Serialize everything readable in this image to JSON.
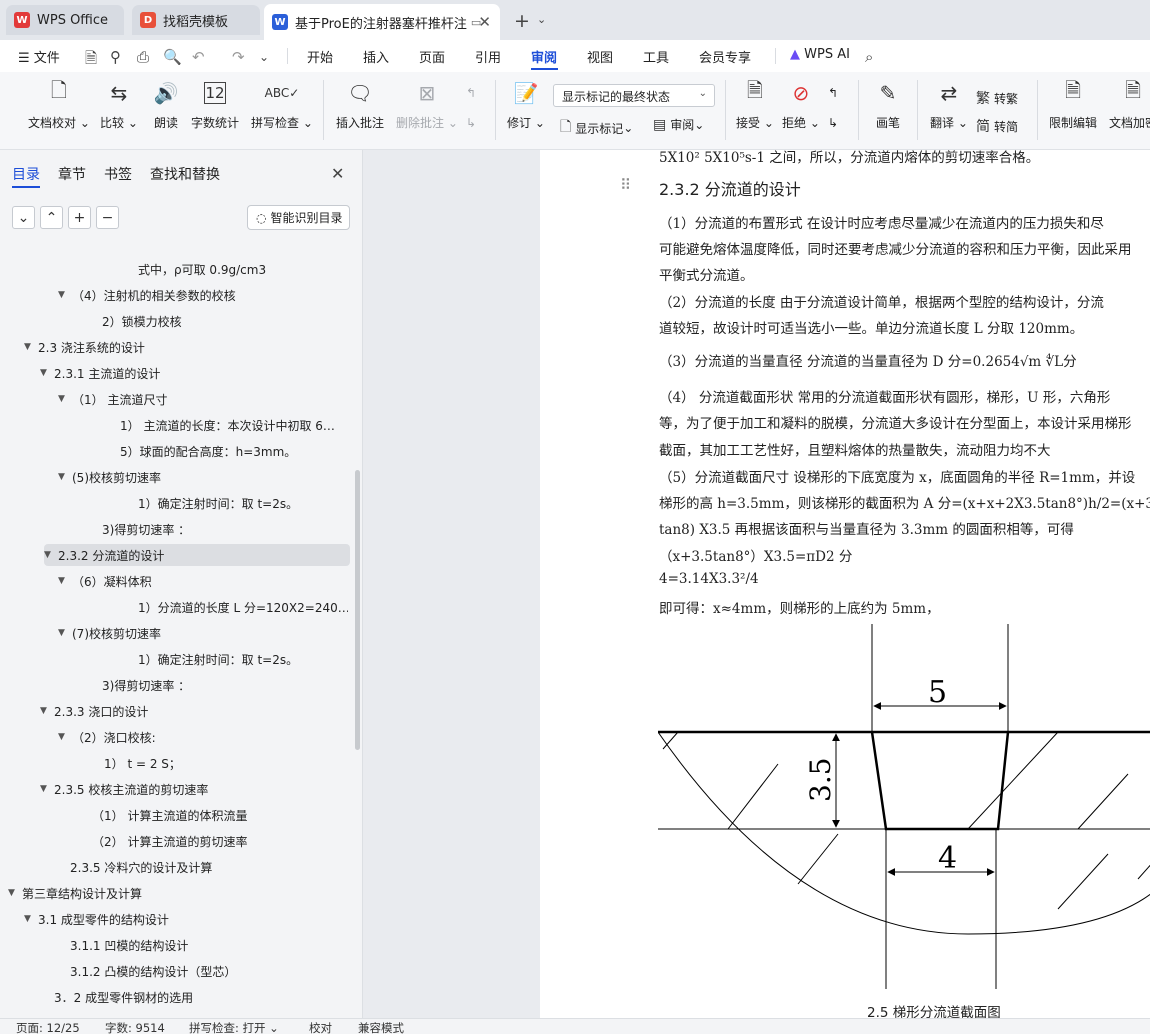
{
  "tabs": [
    {
      "label": "WPS Office",
      "icon": "wps-logo-icon"
    },
    {
      "label": "找稻壳模板",
      "icon": "daoke-logo-icon"
    },
    {
      "label": "基于ProE的注射器塞杆推杆注",
      "icon": "word-doc-icon"
    }
  ],
  "menu": {
    "file": "文件",
    "items": [
      "开始",
      "插入",
      "页面",
      "引用",
      "审阅",
      "视图",
      "工具",
      "会员专享"
    ],
    "active": "审阅",
    "ai": "WPS AI"
  },
  "ribbon": {
    "doc_check": "文档校对",
    "compare": "比较",
    "read_aloud": "朗读",
    "word_count": "字数统计",
    "spell_check": "拼写检查",
    "insert_comment": "插入批注",
    "delete_comment": "删除批注",
    "revise": "修订",
    "markup_state": "显示标记的最终状态",
    "show_markup": "显示标记",
    "review": "审阅",
    "accept": "接受",
    "reject": "拒绝",
    "pen": "画笔",
    "translate": "翻译",
    "to_traditional": "转繁",
    "to_simplified": "转简",
    "restrict_edit": "限制编辑",
    "doc_encrypt": "文档加密"
  },
  "panel": {
    "tabs": [
      "目录",
      "章节",
      "书签",
      "查找和替换"
    ],
    "smart_toc": "智能识别目录",
    "toc": [
      {
        "text": "式中，ρ可取 0.9g/cm3",
        "indent": 138,
        "arrow": false
      },
      {
        "text": "（4）注射机的相关参数的校核",
        "indent": 74,
        "arrow": true
      },
      {
        "text": "2）锁模力校核",
        "indent": 102,
        "arrow": false
      },
      {
        "text": "2.3 浇注系统的设计",
        "indent": 40,
        "arrow": true
      },
      {
        "text": "2.3.1 主流道的设计",
        "indent": 56,
        "arrow": true
      },
      {
        "text": "（1）   主流道尺寸",
        "indent": 74,
        "arrow": true
      },
      {
        "text": "1）   主流道的长度：本次设计中初取 6…",
        "indent": 120,
        "arrow": false
      },
      {
        "text": "5）球面的配合高度：h=3mm。",
        "indent": 120,
        "arrow": false
      },
      {
        "text": "(5)校核剪切速率",
        "indent": 74,
        "arrow": true
      },
      {
        "text": "1）确定注射时间：取 t=2s。",
        "indent": 138,
        "arrow": false
      },
      {
        "text": "3)得剪切速率   ：",
        "indent": 102,
        "arrow": false
      },
      {
        "text": "2.3.2 分流道的设计",
        "indent": 56,
        "arrow": true,
        "selected": true
      },
      {
        "text": "（6）凝料体积",
        "indent": 74,
        "arrow": true
      },
      {
        "text": "1）分流道的长度 L 分=120X2=240…",
        "indent": 138,
        "arrow": false
      },
      {
        "text": "(7)校核剪切速率",
        "indent": 74,
        "arrow": true
      },
      {
        "text": "1）确定注射时间：取 t=2s。",
        "indent": 138,
        "arrow": false
      },
      {
        "text": "3)得剪切速率   ：",
        "indent": 102,
        "arrow": false
      },
      {
        "text": "2.3.3 浇口的设计",
        "indent": 56,
        "arrow": true
      },
      {
        "text": "（2）浇口校核:",
        "indent": 74,
        "arrow": true
      },
      {
        "text": "1）   t = 2 S；",
        "indent": 104,
        "arrow": false
      },
      {
        "text": "2.3.5 校核主流道的剪切速率",
        "indent": 56,
        "arrow": true
      },
      {
        "text": "（1）   计算主流道的体积流量",
        "indent": 92,
        "arrow": false
      },
      {
        "text": "（2）   计算主流道的剪切速率",
        "indent": 92,
        "arrow": false
      },
      {
        "text": "2.3.5 冷料穴的设计及计算",
        "indent": 70,
        "arrow": false
      },
      {
        "text": "第三章结构设计及计算",
        "indent": 24,
        "arrow": true
      },
      {
        "text": "3.1 成型零件的结构设计",
        "indent": 40,
        "arrow": true
      },
      {
        "text": "3.1.1 凹模的结构设计",
        "indent": 70,
        "arrow": false
      },
      {
        "text": "3.1.2 凸模的结构设计（型芯）",
        "indent": 70,
        "arrow": false
      },
      {
        "text": "3．2 成型零件钢材的选用",
        "indent": 54,
        "arrow": false
      }
    ]
  },
  "document": {
    "top_line": "5X10² 5X10⁵s-1 之间，所以，分流道内熔体的剪切速率合格。",
    "heading": "2.3.2 分流道的设计",
    "lines": [
      "   （1）分流道的布置形式   在设计时应考虑尽量减少在流道内的压力损失和尽",
      "可能避免熔体温度降低，同时还要考虑减少分流道的容积和压力平衡，因此采用",
      "平衡式分流道。",
      "   （2）分流道的长度   由于分流道设计简单，根据两个型腔的结构设计，分流",
      "道较短，故设计时可适当选小一些。单边分流道长度 L 分取 120mm。",
      "   （3）分流道的当量直径   分流道的当量直径为 D 分=0.2654√m ∜L分",
      "   （4） 分流道截面形状   常用的分流道截面形状有圆形，梯形，U 形，六角形",
      "等，为了便于加工和凝料的脱模，分流道大多设计在分型面上，本设计采用梯形",
      "截面，其加工工艺性好，且塑料熔体的热量散失，流动阻力均不大",
      "   （5）分流道截面尺寸   设梯形的下底宽度为 x，底面圆角的半径 R=1mm，并设",
      "梯形的高 h=3.5mm，则该梯形的截面积为   A 分=(x+x+2X3.5tan8°)h/2=(x+3.5",
      "tan8) X3.5     再根据该面积与当量直径为 3.3mm 的圆面积相等，可得",
      "（x+3.5tan8°）X3.5=πD2 分",
      " 4=3.14X3.3²/4",
      " 即可得：x≈4mm，则梯形的上底约为 5mm，"
    ],
    "figure": {
      "top_dim": "5",
      "height_dim": "3.5",
      "bottom_dim": "4"
    },
    "caption": "2.5 梯形分流道截面图"
  },
  "status": {
    "page": "页面: 12/25",
    "words": "字数: 9514",
    "spell": "拼写检查: 打开",
    "proof": "校对",
    "compat": "兼容模式"
  },
  "colors": {
    "accent": "#1d4ed8",
    "wps_red": "#e23a3a",
    "doc_blue": "#2b5fd9"
  }
}
